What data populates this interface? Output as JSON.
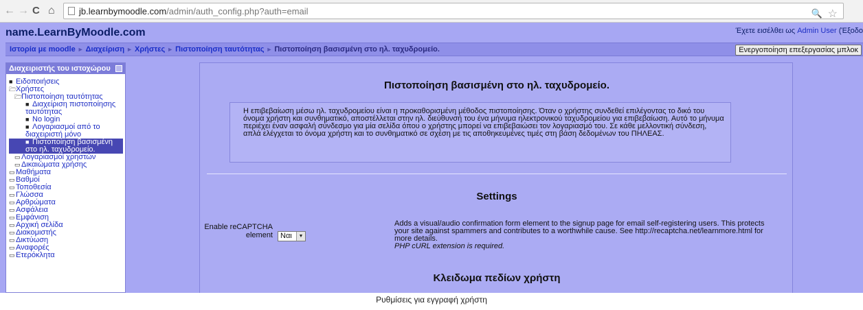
{
  "browser": {
    "url_host": "jb.learnbymoodle.com",
    "url_path": "/admin/auth_config.php?auth=email"
  },
  "header": {
    "site_name": "name.LearnByMoodle.com",
    "login_prefix": "Έχετε εισέλθει ως ",
    "login_user": "Admin User",
    "login_suffix": " (Έξοδο"
  },
  "breadcrumb": {
    "items": [
      "Ιστορία με moodle",
      "Διαχείριση",
      "Χρήστες",
      "Πιστοποίηση ταυτότητας",
      "Πιστοποίηση βασισμένη στο ηλ. ταχυδρομείο."
    ],
    "separator": "►"
  },
  "edit_button": "Ενεργοποίηση επεξεργασίας μπλοκ",
  "sidebar": {
    "title": "Διαχειριστής του ιστοχώρου",
    "items": [
      "Ειδοποιήσεις",
      "Χρήστες",
      "Πιστοποίηση ταυτότητας",
      "Διαχείριση πιστοποίησης ταυτότητας",
      "No login",
      "Λογαριασμοί από το διαχειριστή μόνο",
      "Πιστοποίηση βασισμένη στο ηλ. ταχυδρομείο.",
      "Λογαριασμοί χρηστών",
      "Δικαιώματα χρήσης",
      "Μαθήματα",
      "Βαθμοί",
      "Τοποθεσία",
      "Γλώσσα",
      "Αρθρώματα",
      "Ασφάλεια",
      "Εμφάνιση",
      "Αρχική σελίδα",
      "Διακομιστής",
      "Δικτύωση",
      "Αναφορές",
      "Ετερόκλητα"
    ]
  },
  "main": {
    "title": "Πιστοποίηση βασισμένη στο ηλ. ταχυδρομείο.",
    "description": "Η επιβεβαίωση μέσω ηλ. ταχυδρομείου είναι η προκαθορισμένη μέθοδος πιστοποίησης. Όταν ο χρήστης συνδεθεί επιλέγοντας το δικό του όνομα χρήστη και συνθηματικό, αποστέλλεται στην ηλ. διεύθυνσή του ένα μήνυμα ηλεκτρονικού ταχυδρομείου για επιβεβαίωση. Αυτό το μήνυμα περιέχει έναν ασφαλή σύνδεσμο για μία σελίδα όπου ο χρήστης μπορεί να επιβεβαιώσει τον λογαριασμό του. Σε κάθε μελλοντική σύνδεση, απλά ελέγχεται το όνομα χρήστη και το συνθηματικό σε σχέση με τις αποθηκευμένες τιμές στη βάση δεδομένων του ΠΗΛΕΑΣ.",
    "settings_heading": "Settings",
    "setting_label": "Enable reCAPTCHA element",
    "setting_value": "Ναι",
    "setting_desc": "Adds a visual/audio confirmation form element to the signup page for email self-registering users. This protects your site against spammers and contributes to a worthwhile cause. See http://recaptcha.net/learnmore.html for more details.",
    "setting_note": "PHP cURL extension is required.",
    "lock_heading": "Κλειδωμα πεδίων χρήστη"
  },
  "caption": "Ρυθμίσεις για εγγραφή χρήστη"
}
